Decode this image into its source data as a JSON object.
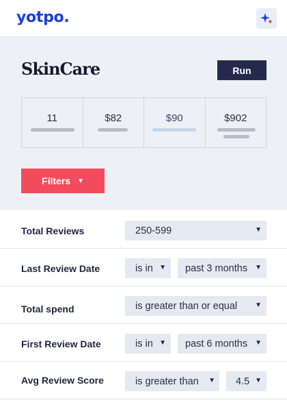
{
  "header": {
    "logo_text": "yotpo.",
    "logo_color": "#1b3fe0",
    "ai_button_icon": "sparkle-icon"
  },
  "panel": {
    "brand_name": "SkinCare",
    "run_label": "Run",
    "stats": [
      "11",
      "$82",
      "$90",
      "$902"
    ],
    "filters_label": "Filters",
    "filters_caret": "▼",
    "filters_color": "#f24b5c"
  },
  "filters": {
    "total_reviews": {
      "label": "Total Reviews",
      "value": "250-599"
    },
    "last_review_date": {
      "label": "Last Review Date",
      "operator": "is in",
      "value": "past 3 months"
    },
    "total_spend": {
      "label": "Total spend",
      "operator": "is greater than or equal"
    },
    "first_review_date": {
      "label": "First Review Date",
      "operator": "is in",
      "value": "past 6 months"
    },
    "avg_review_score": {
      "label": "Avg Review Score",
      "operator": "is greater than",
      "value": "4.5"
    }
  },
  "dropdown_arrow": "▼"
}
